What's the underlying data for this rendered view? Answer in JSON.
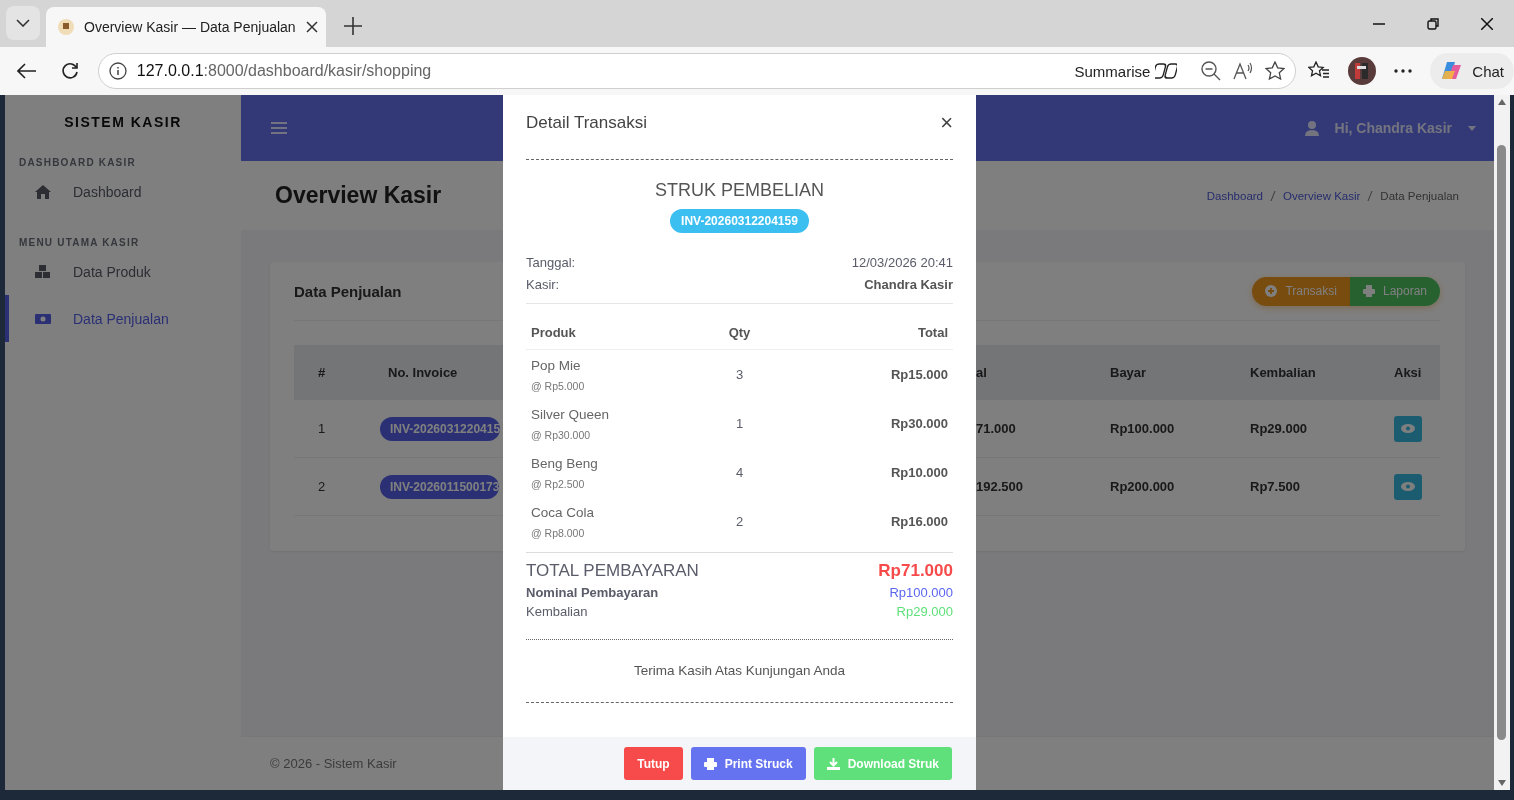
{
  "browser": {
    "tab_title": "Overview Kasir — Data Penjualan",
    "address_host": "127.0.0.1",
    "address_path": ":8000/dashboard/kasir/shopping",
    "summarise": "Summarise",
    "chat": "Chat"
  },
  "sidebar": {
    "brand": "SISTEM KASIR",
    "sections": [
      {
        "heading": "DASHBOARD KASIR",
        "items": [
          {
            "label": "Dashboard",
            "kind": "home",
            "selected": false
          }
        ]
      },
      {
        "heading": "MENU UTAMA KASIR",
        "items": [
          {
            "label": "Data Produk",
            "kind": "products",
            "selected": false
          },
          {
            "label": "Data Penjualan",
            "kind": "sales",
            "selected": true
          }
        ]
      }
    ]
  },
  "topbar": {
    "user": "Hi, Chandra Kasir"
  },
  "page": {
    "title": "Overview Kasir",
    "breadcrumb": [
      {
        "label": "Dashboard",
        "kind": "link"
      },
      {
        "label": "Overview Kasir",
        "kind": "link"
      },
      {
        "label": "Data Penjualan",
        "kind": "current"
      }
    ]
  },
  "card": {
    "title": "Data Penjualan",
    "actions": [
      {
        "label": "Transaksi",
        "kind": "add"
      },
      {
        "label": "Laporan",
        "kind": "print"
      }
    ],
    "table": {
      "columns": [
        "#",
        "No. Invoice",
        "al",
        "Bayar",
        "Kembalian",
        "Aksi"
      ],
      "rows": [
        {
          "no": "1",
          "invoice": "INV-2026031220415",
          "total": "71.000",
          "bayar": "Rp100.000",
          "kembalian": "Rp29.000"
        },
        {
          "no": "2",
          "invoice": "INV-2026011500173",
          "total": "192.500",
          "bayar": "Rp200.000",
          "kembalian": "Rp7.500"
        }
      ]
    }
  },
  "footer": "© 2026 - Sistem Kasir",
  "modal": {
    "title": "Detail Transaksi",
    "close": "×",
    "receipt_title": "STRUK PEMBELIAN",
    "invoice": "INV-20260312204159",
    "meta": [
      {
        "label": "Tanggal:",
        "value": "12/03/2026 20:41",
        "kind": "plain"
      },
      {
        "label": "Kasir:",
        "value": "Chandra Kasir",
        "kind": "bold"
      }
    ],
    "columns": [
      "Produk",
      "Qty",
      "Total"
    ],
    "items": [
      {
        "name": "Pop Mie",
        "price": "@ Rp5.000",
        "qty": "3",
        "total": "Rp15.000"
      },
      {
        "name": "Silver Queen",
        "price": "@ Rp30.000",
        "qty": "1",
        "total": "Rp30.000"
      },
      {
        "name": "Beng Beng",
        "price": "@ Rp2.500",
        "qty": "4",
        "total": "Rp10.000"
      },
      {
        "name": "Coca Cola",
        "price": "@ Rp8.000",
        "qty": "2",
        "total": "Rp16.000"
      }
    ],
    "summary": [
      {
        "label": "TOTAL PEMBAYARAN",
        "value": "Rp71.000",
        "kind": "total"
      },
      {
        "label": "Nominal Pembayaran",
        "value": "Rp100.000",
        "kind": "paid"
      },
      {
        "label": "Kembalian",
        "value": "Rp29.000",
        "kind": "change"
      }
    ],
    "thanks": "Terima Kasih Atas Kunjungan Anda",
    "buttons": [
      {
        "label": "Tutup",
        "kind": "close"
      },
      {
        "label": "Print Struck",
        "kind": "print"
      },
      {
        "label": "Download Struk",
        "kind": "download"
      }
    ]
  }
}
